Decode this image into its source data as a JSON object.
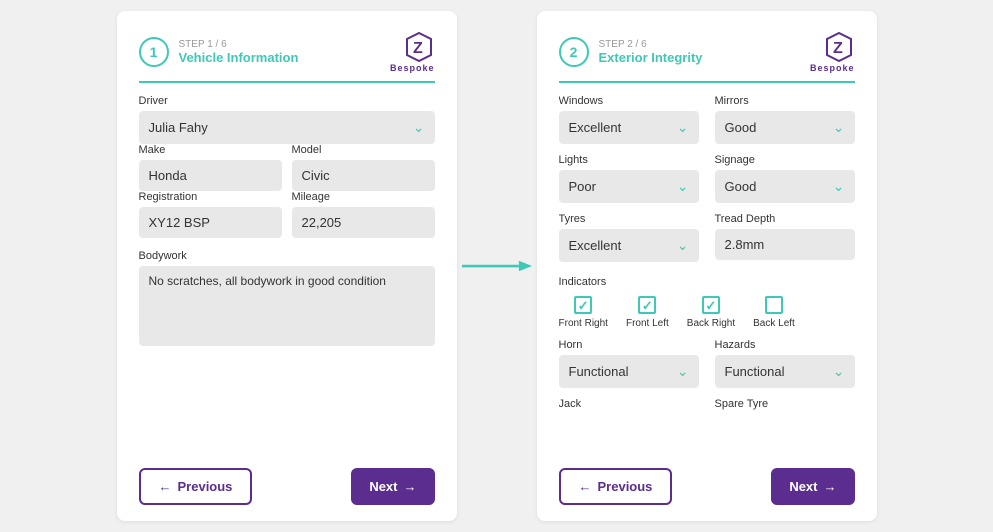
{
  "left_panel": {
    "step_num": "1",
    "step_label": "STEP 1 / 6",
    "step_title": "Vehicle Information",
    "logo_z": "Z",
    "logo_sub": "Bespoke",
    "driver_label": "Driver",
    "driver_value": "Julia Fahy",
    "make_label": "Make",
    "make_value": "Honda",
    "model_label": "Model",
    "model_value": "Civic",
    "registration_label": "Registration",
    "registration_value": "XY12 BSP",
    "mileage_label": "Mileage",
    "mileage_value": "22,205",
    "bodywork_label": "Bodywork",
    "bodywork_value": "No scratches, all bodywork in good condition",
    "btn_previous": "Previous",
    "btn_next": "Next"
  },
  "right_panel": {
    "step_num": "2",
    "step_label": "STEP 2 / 6",
    "step_title": "Exterior Integrity",
    "logo_z": "Z",
    "logo_sub": "Bespoke",
    "windows_label": "Windows",
    "windows_value": "Excellent",
    "mirrors_label": "Mirrors",
    "mirrors_value": "Good",
    "lights_label": "Lights",
    "lights_value": "Poor",
    "signage_label": "Signage",
    "signage_value": "Good",
    "tyres_label": "Tyres",
    "tyres_value": "Excellent",
    "tread_label": "Tread Depth",
    "tread_value": "2.8mm",
    "indicators_label": "Indicators",
    "indicators": [
      {
        "label": "Front Right",
        "checked": true
      },
      {
        "label": "Front Left",
        "checked": true
      },
      {
        "label": "Back Right",
        "checked": true
      },
      {
        "label": "Back Left",
        "checked": false
      }
    ],
    "horn_label": "Horn",
    "horn_value": "Functional",
    "hazards_label": "Hazards",
    "hazards_value": "Functional",
    "jack_label": "Jack",
    "spare_label": "Spare Tyre",
    "btn_previous": "Previous",
    "btn_next": "Next"
  },
  "colors": {
    "teal": "#3ec9b6",
    "purple": "#5b2d8e"
  }
}
